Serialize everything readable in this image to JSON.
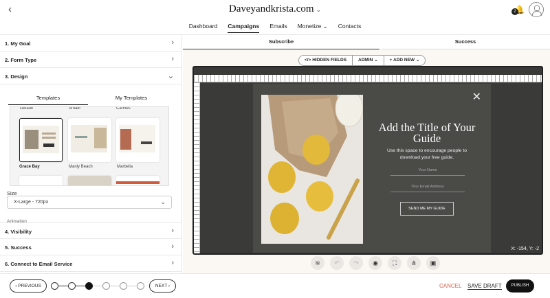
{
  "header": {
    "back_icon": "‹",
    "site_title": "Daveyandkrista.com",
    "site_chevron": "⌄",
    "notification_count": "2",
    "nav": [
      {
        "label": "Dashboard"
      },
      {
        "label": "Campaigns"
      },
      {
        "label": "Emails"
      },
      {
        "label": "Monetize ⌄"
      },
      {
        "label": "Contacts"
      }
    ]
  },
  "sidebar": {
    "sections_top": [
      {
        "label": "1. My Goal",
        "arrow": "›"
      },
      {
        "label": "2. Form Type",
        "arrow": "›"
      },
      {
        "label": "3. Design",
        "arrow": "⌄"
      }
    ],
    "design_tabs": [
      "Templates",
      "My Templates"
    ],
    "template_captions_top": [
      "Default",
      "Amalfi",
      "Cannes"
    ],
    "templates": [
      {
        "name": "Grace Bay",
        "selected": true
      },
      {
        "name": "Manly Beach",
        "selected": false
      },
      {
        "name": "Marbella",
        "selected": false
      }
    ],
    "size_label": "Size",
    "size_value": "X-Large - 720px",
    "size_chevron": "⌄",
    "animation_label": "Animation",
    "sections_bottom": [
      {
        "label": "4. Visibility",
        "arrow": "›"
      },
      {
        "label": "5. Success",
        "arrow": "›"
      },
      {
        "label": "6. Connect to Email Service",
        "arrow": "›"
      }
    ]
  },
  "main": {
    "tabs": [
      "Subscribe",
      "Success"
    ],
    "toolbar": [
      "</> HIDDEN FIELDS",
      "ADMIN ⌄",
      "+ ADD NEW ⌄"
    ],
    "popup": {
      "close": "✕",
      "title": "Add the Title of Your Guide",
      "subtitle": "Use this space to encourage people to download your free guide.",
      "name_placeholder": "Your Name",
      "email_placeholder": "Your Email Address",
      "button": "SEND ME MY GUIDE"
    },
    "coords": "X: -154, Y: -2",
    "icons": [
      "layers-icon",
      "undo-icon",
      "redo-icon",
      "eye-icon",
      "focus-icon",
      "share-icon",
      "save-icon"
    ]
  },
  "footer": {
    "previous": "‹ PREVIOUS",
    "next": "NEXT ›",
    "steps_total": 6,
    "current_step": 3,
    "cancel": "CANCEL",
    "save_draft": "SAVE DRAFT",
    "publish": "PUBLISH"
  }
}
